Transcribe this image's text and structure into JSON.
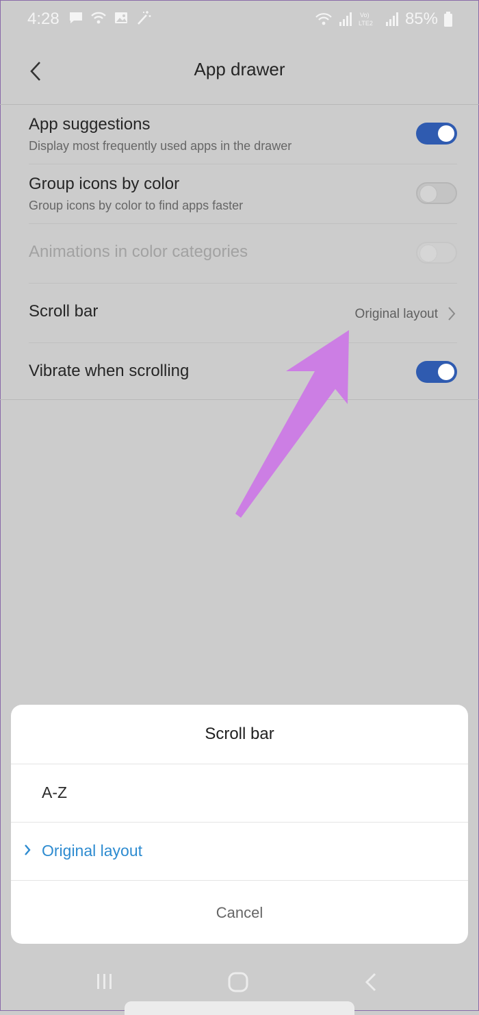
{
  "status_bar": {
    "time": "4:28",
    "battery_text": "85%",
    "left_icons": [
      "message-icon",
      "wifi-icon",
      "image-icon",
      "magic-wand-icon"
    ],
    "right_icons": [
      "wifi-icon",
      "signal-icon",
      "volte-icon",
      "signal-icon",
      "battery-icon"
    ],
    "volte_label": "Vo)",
    "lte_label": "LTE2"
  },
  "header": {
    "title": "App drawer",
    "back_icon": "back-arrow-icon"
  },
  "settings": {
    "items": [
      {
        "title": "App suggestions",
        "subtitle": "Display most frequently used apps in the drawer",
        "control": "toggle",
        "state": "on"
      },
      {
        "title": "Group icons by color",
        "subtitle": "Group icons by color to find apps faster",
        "control": "toggle",
        "state": "off"
      },
      {
        "title": "Animations in color categories",
        "control": "toggle",
        "state": "disabled"
      },
      {
        "title": "Scroll bar",
        "value": "Original layout",
        "control": "chevron"
      },
      {
        "title": "Vibrate when scrolling",
        "control": "toggle",
        "state": "on"
      }
    ]
  },
  "sheet": {
    "title": "Scroll bar",
    "options": [
      {
        "label": "A-Z",
        "selected": false
      },
      {
        "label": "Original layout",
        "selected": true
      }
    ],
    "cancel_label": "Cancel"
  },
  "colors": {
    "accent": "#2f5bb0",
    "selected_text": "#2d8bd0",
    "annotation_arrow": "#cc7ee4",
    "background": "#cccccc"
  }
}
